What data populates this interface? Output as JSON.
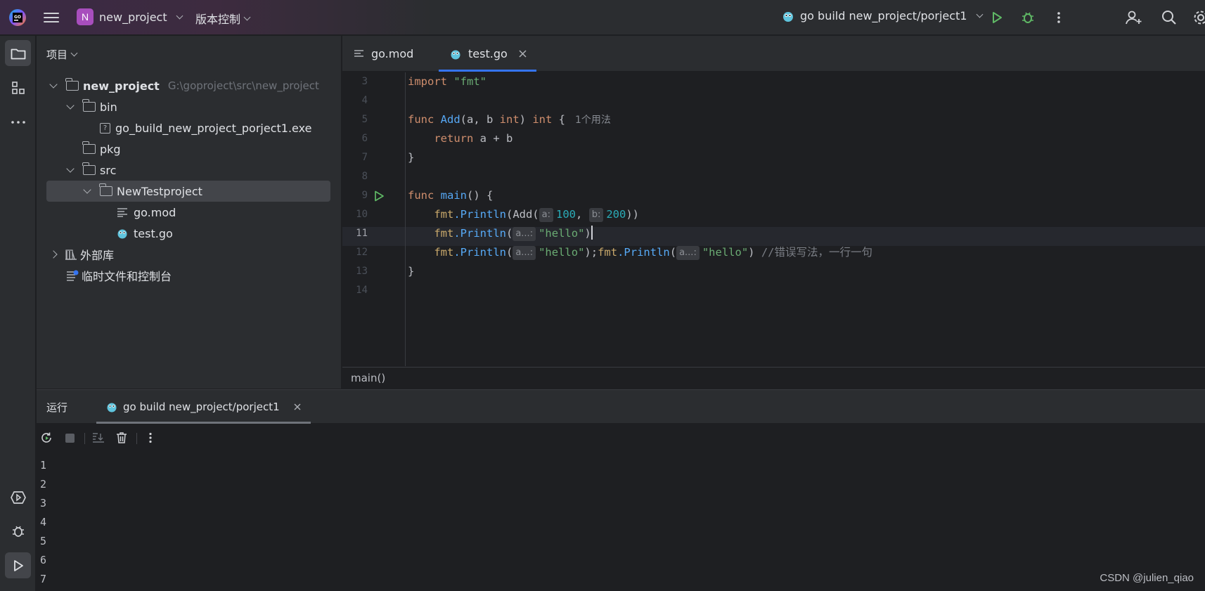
{
  "titlebar": {
    "project_initial": "N",
    "project_name": "new_project",
    "vcs_label": "版本控制",
    "run_config": "go build new_project/porject1",
    "accent_color": "#a84ebd"
  },
  "toolstrip": {
    "top_icons": [
      "folder-icon",
      "structure-icon",
      "more-icon"
    ],
    "bottom_icons": [
      "services-icon",
      "debug-icon",
      "run-icon"
    ]
  },
  "project_panel": {
    "header": "项目",
    "tree": [
      {
        "label": "new_project",
        "hint": "G:\\goproject\\src\\new_project",
        "type": "folder",
        "expanded": true
      },
      {
        "label": "bin",
        "type": "folder",
        "expanded": true
      },
      {
        "label": "go_build_new_project_porject1.exe",
        "type": "unknown-file"
      },
      {
        "label": "pkg",
        "type": "folder"
      },
      {
        "label": "src",
        "type": "folder",
        "expanded": true
      },
      {
        "label": "NewTestproject",
        "type": "folder",
        "expanded": true,
        "selected": true
      },
      {
        "label": "go.mod",
        "type": "text-file"
      },
      {
        "label": "test.go",
        "type": "go-file"
      },
      {
        "label": "外部库",
        "type": "library",
        "expanded": false
      },
      {
        "label": "临时文件和控制台",
        "type": "scratch"
      }
    ]
  },
  "editor": {
    "tabs": [
      {
        "label": "go.mod",
        "active": false
      },
      {
        "label": "test.go",
        "active": true
      }
    ],
    "line_numbers": [
      "3",
      "4",
      "5",
      "6",
      "7",
      "8",
      "9",
      "10",
      "11",
      "12",
      "13",
      "14"
    ],
    "current_line": "11",
    "code": {
      "l3_kw": "import",
      "l3_str": "\"fmt\"",
      "l5_kw": "func",
      "l5_fn": "Add",
      "l5_params_a": "(a, b ",
      "l5_type1": "int",
      "l5_close": ") ",
      "l5_type2": "int",
      "l5_brace": " {",
      "l5_usage": "1个用法",
      "l6_kw": "return",
      "l6_expr": " a + b",
      "l7": "}",
      "l9_kw": "func",
      "l9_fn": "main",
      "l9_rest": "() {",
      "l10_pkg": "fmt",
      "l10_fn": ".Println",
      "l10_open": "(Add(",
      "l10_hint_a": "a:",
      "l10_num1": "100",
      "l10_comma": ", ",
      "l10_hint_b": "b:",
      "l10_num2": "200",
      "l10_close": "))",
      "l11_pkg": "fmt",
      "l11_fn": ".Println",
      "l11_open": "(",
      "l11_hint": "a...:",
      "l11_str": "\"hello\"",
      "l11_close": ")",
      "l12_pkg": "fmt",
      "l12_fn": ".Println",
      "l12_open": "(",
      "l12_hint1": "a...:",
      "l12_str1": "\"hello\"",
      "l12_mid": ");",
      "l12_pkg2": "fmt",
      "l12_fn2": ".Println",
      "l12_open2": "(",
      "l12_hint2": "a...:",
      "l12_str2": "\"hello\"",
      "l12_close2": ") ",
      "l12_comment": "//错误写法，一行一句",
      "l13": "}"
    },
    "breadcrumb": "main()"
  },
  "run_panel": {
    "title": "运行",
    "tab_label": "go build new_project/porject1",
    "output": [
      "1",
      "2",
      "3",
      "4",
      "5",
      "6",
      "7"
    ]
  },
  "watermark": "CSDN @julien_qiao"
}
